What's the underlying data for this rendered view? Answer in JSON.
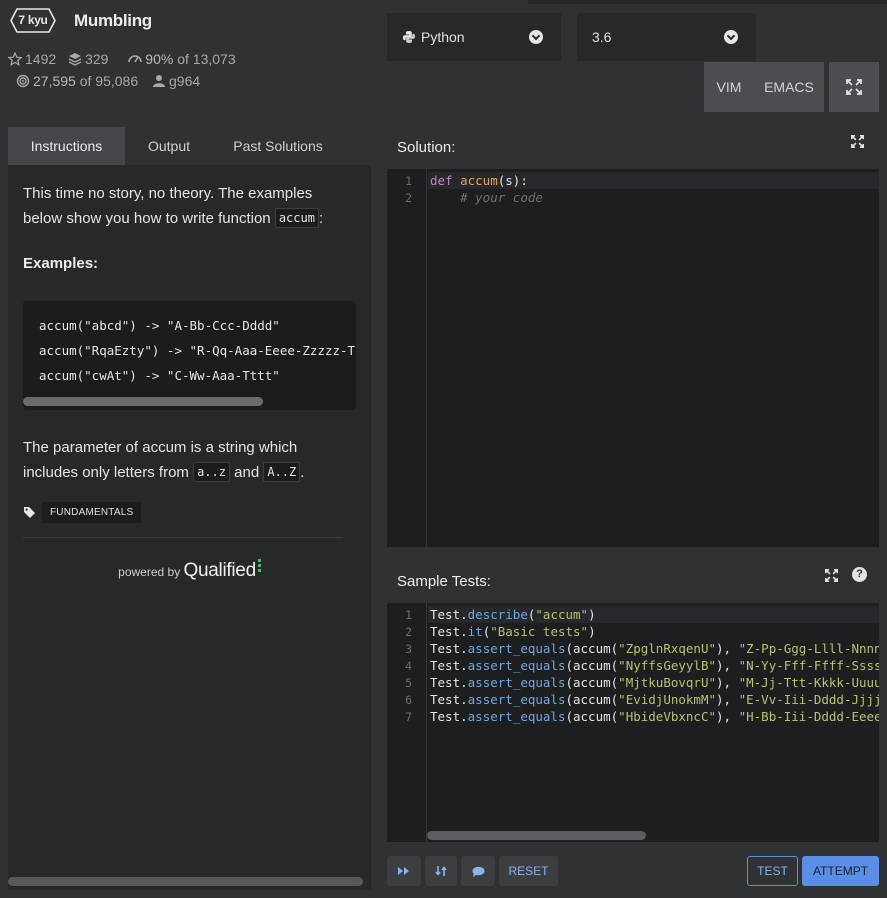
{
  "kata": {
    "rank": "7 kyu",
    "title": "Mumbling"
  },
  "stats": {
    "stars": "1492",
    "collections": "329",
    "satisfaction": "90%",
    "satisfaction_of": "of 13,073",
    "completed": "27,595",
    "completed_of": "of 95,086",
    "author": "g964"
  },
  "language_select": {
    "value": "Python",
    "icon": "python-icon"
  },
  "version_select": {
    "value": "3.6"
  },
  "editor_modes": {
    "vim": "VIM",
    "emacs": "EMACS",
    "fullscreen_icon": "expand-icon"
  },
  "tabs": [
    {
      "label": "Instructions",
      "active": true
    },
    {
      "label": "Output",
      "active": false
    },
    {
      "label": "Past Solutions",
      "active": false
    }
  ],
  "instructions": {
    "intro_text": "This time no story, no theory. The examples below show you how to write function",
    "intro_code": "accum",
    "intro_end": ":",
    "examples_heading": "Examples:",
    "examples": [
      "accum(\"abcd\") -> \"A-Bb-Ccc-Dddd\"",
      "accum(\"RqaEzty\") -> \"R-Qq-Aaa-Eeee-Zzzzz-Tttttt-Yyyyyyy\"",
      "accum(\"cwAt\") -> \"C-Ww-Aaa-Tttt\""
    ],
    "param_text_1": "The parameter of accum is a string which includes only letters from",
    "param_code_1": "a..z",
    "param_and": "and",
    "param_code_2": "A..Z",
    "param_end": ".",
    "tag": "FUNDAMENTALS",
    "powered_by": "powered by",
    "qualified": "Qualified"
  },
  "solution": {
    "title": "Solution:",
    "lines": [
      {
        "num": "1",
        "kw": "def",
        "fn": "accum",
        "rest": "(s):"
      },
      {
        "num": "2",
        "comment": "# your code"
      }
    ]
  },
  "sample_tests": {
    "title": "Sample Tests:",
    "help_icon": "question-icon",
    "lines": [
      {
        "num": "1",
        "obj": "Test.",
        "meth": "describe",
        "open": "(",
        "arg": "\"accum\"",
        "close": ")"
      },
      {
        "num": "2",
        "obj": "Test.",
        "meth": "it",
        "open": "(",
        "arg": "\"Basic tests\"",
        "close": ")"
      },
      {
        "num": "3",
        "obj": "Test.",
        "meth": "assert_equals",
        "open": "(accum(",
        "arg": "\"ZpglnRxqenU\"",
        "close": "), ",
        "expected": "\"Z-Pp-Ggg-Llll-Nnnnn-Rrrrrr-Xxxxxxx-Qqqqqqqq-Eeeeeeeee-Nnnnnnnnnn-Uuuuuuuuuuu\")"
      },
      {
        "num": "4",
        "obj": "Test.",
        "meth": "assert_equals",
        "open": "(accum(",
        "arg": "\"NyffsGeyylB\"",
        "close": "), ",
        "expected": "\"N-Yy-Fff-Ffff-Sssss-Gggggg-Eeeeeee-Yyyyyyyy-Yyyyyyyyy-Llllllllll-Bbbbbbbbbbb\")"
      },
      {
        "num": "5",
        "obj": "Test.",
        "meth": "assert_equals",
        "open": "(accum(",
        "arg": "\"MjtkuBovqrU\"",
        "close": "), ",
        "expected": "\"M-Jj-Ttt-Kkkk-Uuuuu-Bbbbbb-Ooooooo-Vvvvvvvv-Qqqqqqqqq-Rrrrrrrrrr-Uuuuuuuuuuu\")"
      },
      {
        "num": "6",
        "obj": "Test.",
        "meth": "assert_equals",
        "open": "(accum(",
        "arg": "\"EvidjUnokmM\"",
        "close": "), ",
        "expected": "\"E-Vv-Iii-Dddd-Jjjjj-Uuuuuu-Nnnnnnn-Oooooooo-Kkkkkkkkk-Mmmmmmmmmm-Mmmmmmmmmmm\")"
      },
      {
        "num": "7",
        "obj": "Test.",
        "meth": "assert_equals",
        "open": "(accum(",
        "arg": "\"HbideVbxncC\"",
        "close": "), ",
        "expected": "\"H-Bb-Iii-Dddd-Eeeee-Vvvvvv-Bbbbbbb-Xxxxxxxx-Nnnnnnnnn-Cccccccccc-Ccccccccccc\")"
      }
    ]
  },
  "bottom_bar": {
    "skip_icon": "fast-forward-icon",
    "refresh_icon": "refresh-icon",
    "discuss_icon": "chat-icon",
    "reset": "RESET",
    "test": "TEST",
    "attempt": "ATTEMPT"
  },
  "colors": {
    "background": "#303133",
    "panel": "#27282a",
    "accent": "#5b8fe6",
    "keyword": "#c586c0",
    "function": "#e8a54d",
    "string": "#b5c56a",
    "method": "#6fa9e0"
  }
}
